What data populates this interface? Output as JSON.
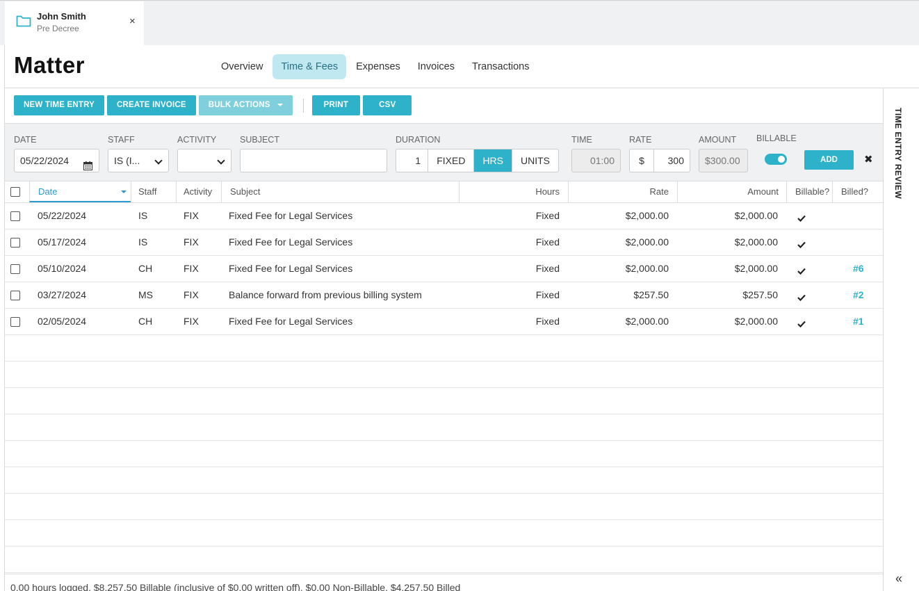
{
  "tab": {
    "name": "John Smith",
    "subtitle": "Pre Decree",
    "close": "×"
  },
  "page_title": "Matter",
  "nav_tabs": [
    "Overview",
    "Time & Fees",
    "Expenses",
    "Invoices",
    "Transactions"
  ],
  "active_tab": "Time & Fees",
  "toolbar": {
    "new_time_entry": "NEW TIME ENTRY",
    "create_invoice": "CREATE INVOICE",
    "bulk_actions": "BULK ACTIONS",
    "print": "PRINT",
    "csv": "CSV"
  },
  "entry_form": {
    "date_label": "DATE",
    "date_value": "05/22/2024",
    "staff_label": "STAFF",
    "staff_value": "IS (I...",
    "activity_label": "ACTIVITY",
    "activity_value": "",
    "subject_label": "SUBJECT",
    "subject_value": "",
    "duration_label": "DURATION",
    "duration_value": "1",
    "duration_modes": [
      "FIXED",
      "HRS",
      "UNITS"
    ],
    "duration_mode_selected": "HRS",
    "time_label": "TIME",
    "time_value": "01:00",
    "rate_label": "RATE",
    "rate_currency": "$",
    "rate_value": "300",
    "amount_label": "AMOUNT",
    "amount_value": "$300.00",
    "billable_label": "BILLABLE",
    "billable_on": true,
    "add_button": "ADD",
    "clear": "✖"
  },
  "grid": {
    "columns": {
      "date": "Date",
      "staff": "Staff",
      "activity": "Activity",
      "subject": "Subject",
      "hours": "Hours",
      "rate": "Rate",
      "amount": "Amount",
      "billable": "Billable?",
      "billed": "Billed?"
    },
    "rows": [
      {
        "date": "05/22/2024",
        "staff": "IS",
        "activity": "FIX",
        "subject": "Fixed Fee for Legal Services",
        "hours": "Fixed",
        "rate": "$2,000.00",
        "amount": "$2,000.00",
        "billable": true,
        "billed": ""
      },
      {
        "date": "05/17/2024",
        "staff": "IS",
        "activity": "FIX",
        "subject": "Fixed Fee for Legal Services",
        "hours": "Fixed",
        "rate": "$2,000.00",
        "amount": "$2,000.00",
        "billable": true,
        "billed": ""
      },
      {
        "date": "05/10/2024",
        "staff": "CH",
        "activity": "FIX",
        "subject": "Fixed Fee for Legal Services",
        "hours": "Fixed",
        "rate": "$2,000.00",
        "amount": "$2,000.00",
        "billable": true,
        "billed": "#6"
      },
      {
        "date": "03/27/2024",
        "staff": "MS",
        "activity": "FIX",
        "subject": "Balance forward from previous billing system",
        "hours": "Fixed",
        "rate": "$257.50",
        "amount": "$257.50",
        "billable": true,
        "billed": "#2"
      },
      {
        "date": "02/05/2024",
        "staff": "CH",
        "activity": "FIX",
        "subject": "Fixed Fee for Legal Services",
        "hours": "Fixed",
        "rate": "$2,000.00",
        "amount": "$2,000.00",
        "billable": true,
        "billed": "#1"
      }
    ]
  },
  "footer_summary": "0.00 hours logged, $8,257.50 Billable (inclusive of $0.00 written off), $0.00 Non-Billable, $4,257.50 Billed",
  "right_panel": {
    "title": "TIME ENTRY REVIEW",
    "collapse": "«"
  },
  "colors": {
    "accent": "#2db2c9",
    "active_tab_bg": "#bfe8f1",
    "sort_blue": "#2a9bd0"
  }
}
